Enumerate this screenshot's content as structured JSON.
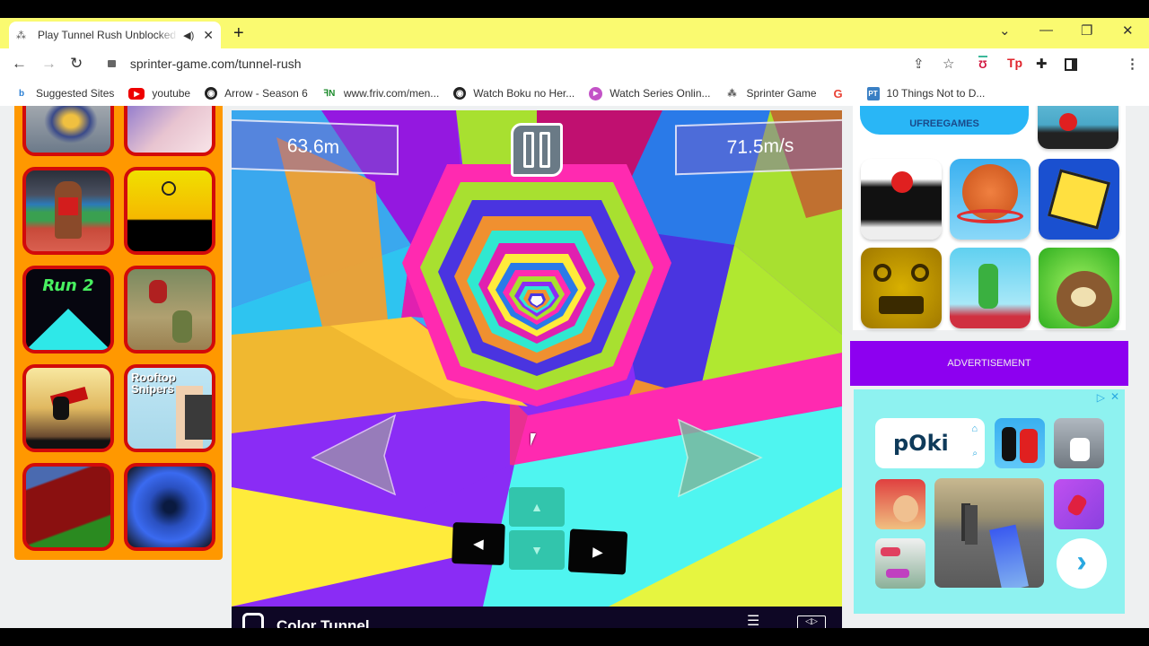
{
  "browser": {
    "tab": {
      "title": "Play Tunnel Rush Unblocked",
      "favicon": "sprinter-icon",
      "audio_icon": "speaker-icon",
      "close": "✕"
    },
    "new_tab": "+",
    "window_controls": {
      "tab_search": "⌄",
      "minimize": "—",
      "restore": "❐",
      "close": "✕"
    },
    "nav": {
      "back": "←",
      "forward": "→",
      "reload": "↻"
    },
    "url": "sprinter-game.com/tunnel-rush",
    "toolbar_icons": [
      "share-icon",
      "star-icon",
      "mcafee-icon",
      "tp-icon",
      "extensions-icon",
      "side-panel-icon",
      "menu-icon"
    ],
    "bookmarks": [
      {
        "label": "Suggested Sites",
        "icon": "bing-icon"
      },
      {
        "label": "youtube",
        "icon": "youtube-icon"
      },
      {
        "label": "Arrow - Season 6",
        "icon": "globe-icon"
      },
      {
        "label": "www.friv.com/men...",
        "icon": "friv-icon"
      },
      {
        "label": "Watch Boku no Her...",
        "icon": "globe-icon"
      },
      {
        "label": "Watch Series Onlin...",
        "icon": "play-icon"
      },
      {
        "label": "Sprinter Game",
        "icon": "sprinter-icon"
      },
      {
        "label": "",
        "icon": "google-icon"
      },
      {
        "label": "10 Things Not to D...",
        "icon": "pt-icon"
      }
    ]
  },
  "left_games": [
    {
      "name": "robot-game"
    },
    {
      "name": "mouse-game"
    },
    {
      "name": "sprinter"
    },
    {
      "name": "stickman-run"
    },
    {
      "name": "Run 2"
    },
    {
      "name": "ninja-fight"
    },
    {
      "name": "ninja-jump"
    },
    {
      "name": "Rooftop Snipers"
    },
    {
      "name": "track-race"
    },
    {
      "name": "tunnel-game"
    }
  ],
  "game": {
    "distance": "63.6m",
    "speed": "71.5m/s",
    "pause_icon": "pause-icon",
    "controls": {
      "left": "◀",
      "right": "▶",
      "up": "▲",
      "down": "▼"
    },
    "footer_title": "Color Tunnel"
  },
  "right_panel": {
    "ufreegames_label": "UFREEGAMES",
    "games": [
      "table-tennis",
      "helix-jump",
      "basketball",
      "geometry-dash",
      "temple-run",
      "archer",
      "teddy-bear"
    ]
  },
  "advertisement": {
    "label": "ADVERTISEMENT",
    "ad_brand": "POKI",
    "next_icon": "›"
  }
}
